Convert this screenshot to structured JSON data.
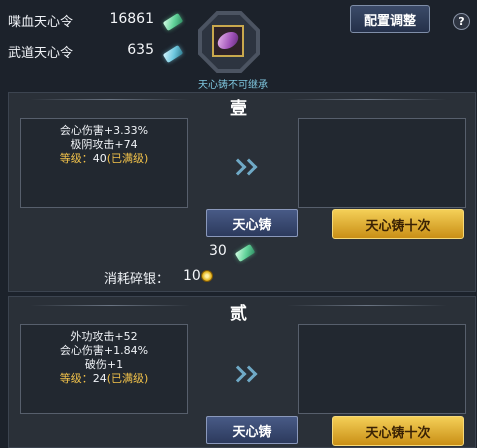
{
  "resources": {
    "blood_token": {
      "label": "喋血天心令",
      "value": "16861",
      "icon": "green-jade-token-icon"
    },
    "martial_token": {
      "label": "武道天心令",
      "value": "635",
      "icon": "teal-jade-token-icon"
    }
  },
  "item_slot": {
    "icon": "purple-gem-icon",
    "note": "天心铸不可继承"
  },
  "header": {
    "config_label": "配置调整",
    "help_label": "?"
  },
  "sections": [
    {
      "title": "壹",
      "stats": [
        "会心伤害+3.33%",
        "极阴攻击+74"
      ],
      "level_label": "等级：",
      "level_value": "40",
      "level_note": "(已满级)",
      "forge_label": "天心铸",
      "forge_ten_label": "天心铸十次",
      "cost_value": "30",
      "cost_icon": "green-jade-token-icon",
      "silver_label": "消耗碎银：",
      "silver_value": "10",
      "silver_icon": "gold-coin-icon"
    },
    {
      "title": "贰",
      "stats": [
        "外功攻击+52",
        "会心伤害+1.84%",
        "破伤+1"
      ],
      "level_label": "等级：",
      "level_value": "24",
      "level_note": "(已满级)",
      "forge_label": "天心铸",
      "forge_ten_label": "天心铸十次"
    }
  ],
  "colors": {
    "accent_gold": "#f2c24a",
    "note_cyan": "#7fc7df",
    "background": "#1c222b"
  }
}
